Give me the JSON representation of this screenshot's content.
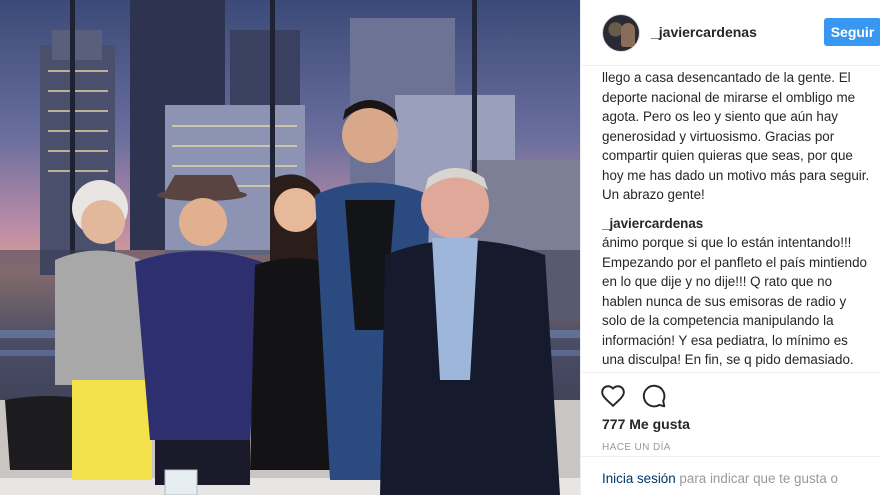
{
  "post": {
    "username": "_javiercardenas",
    "follow_label": "Seguir"
  },
  "caption": {
    "lines_visible": "llego a casa desencantado de la gente. El deporte nacional de mirarse el ombligo me agota. Pero os leo y siento que aún hay generosidad y virtuosismo. Gracias por compartir quien quieras que seas, por que hoy me has dado un motivo más para seguir. Un abrazo gente!"
  },
  "comment": {
    "username": "_javiercardenas",
    "text": "ánimo porque si que lo están intentando!!! Empezando por el panfleto el país mintiendo en lo que dije y no dije!!! Q rato que no hablen nunca de sus emisoras de radio y solo de la competencia manipulando la información! Y esa pediatra, lo mínimo es una disculpa! En fin, se q pido demasiado."
  },
  "actions": {
    "like_icon": "heart-icon",
    "comment_icon": "comment-icon"
  },
  "stats": {
    "likes": "777 Me gusta",
    "time": "HACE UN DÍA"
  },
  "login": {
    "link": "Inicia sesión",
    "text": " para indicar que te gusta o"
  },
  "colors": {
    "accent": "#3897f0",
    "text": "#262626",
    "muted": "#999999",
    "link": "#003569"
  }
}
